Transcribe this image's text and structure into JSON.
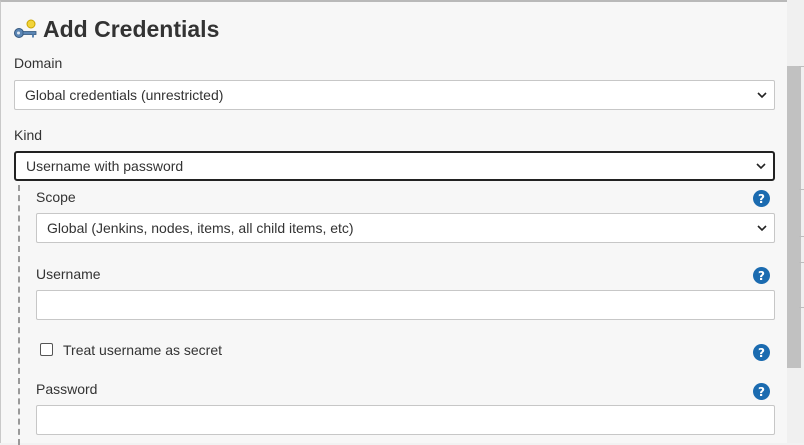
{
  "dialog": {
    "title": "Add Credentials",
    "domain": {
      "label": "Domain",
      "value": "Global credentials (unrestricted)"
    },
    "kind": {
      "label": "Kind",
      "value": "Username with password"
    },
    "scope": {
      "label": "Scope",
      "value": "Global (Jenkins, nodes, items, all child items, etc)"
    },
    "username": {
      "label": "Username",
      "value": ""
    },
    "treat_secret": {
      "label": "Treat username as secret",
      "checked": false
    },
    "password": {
      "label": "Password",
      "value": ""
    },
    "help_glyph": "?"
  },
  "colors": {
    "help_icon": "#1b6bb0",
    "background": "#f7f7f7",
    "focus_border": "#222222"
  }
}
